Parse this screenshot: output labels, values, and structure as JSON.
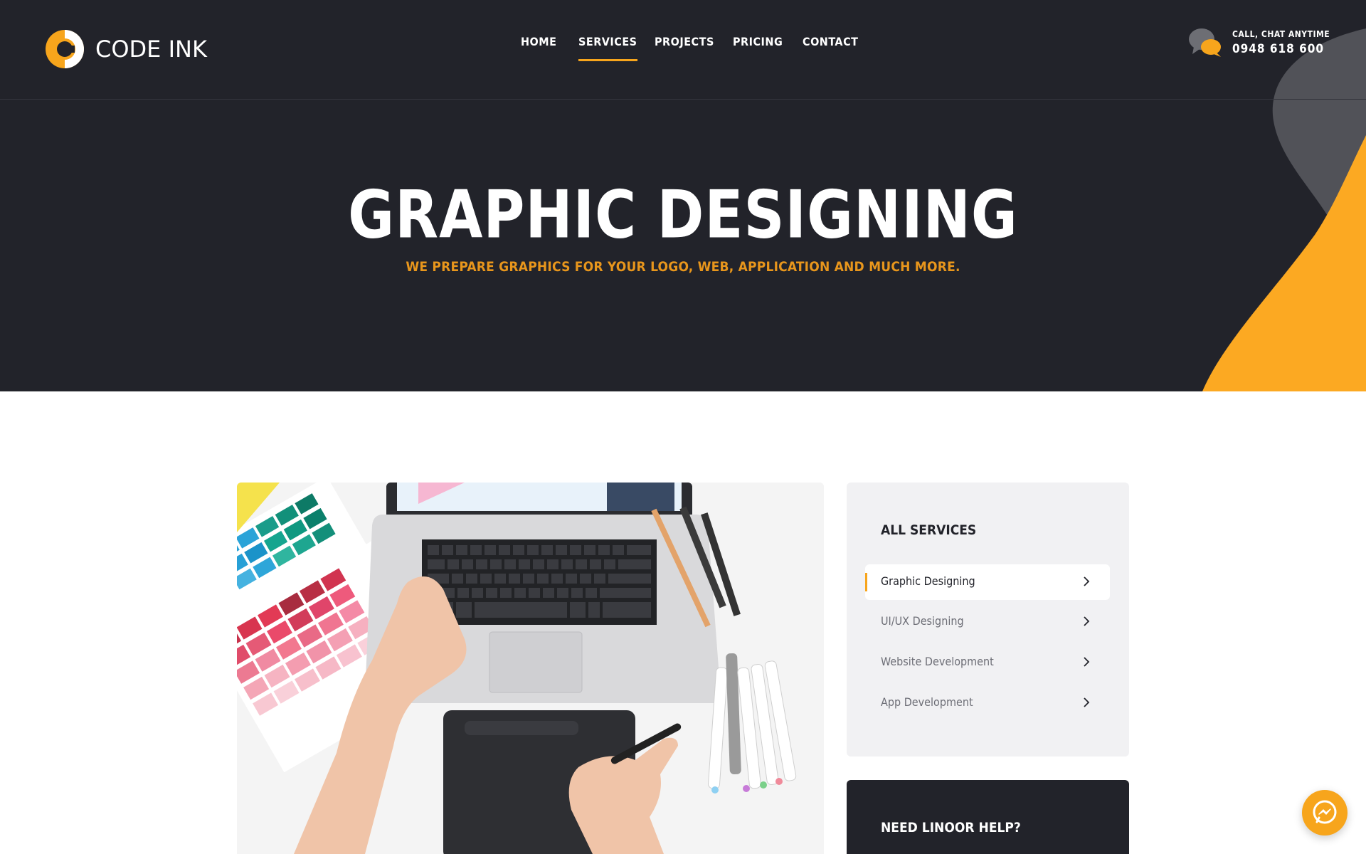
{
  "brand": {
    "name": "CODE INK",
    "accent": "#f7a51c",
    "dark": "#22232a"
  },
  "nav": {
    "items": [
      {
        "label": "HOME",
        "active": false
      },
      {
        "label": "SERVICES",
        "active": true
      },
      {
        "label": "PROJECTS",
        "active": false
      },
      {
        "label": "PRICING",
        "active": false
      },
      {
        "label": "CONTACT",
        "active": false
      }
    ]
  },
  "contact": {
    "label": "CALL, CHAT ANYTIME",
    "phone": "0948 618 600",
    "icon": "chat-bubbles-icon"
  },
  "hero": {
    "title": "GRAPHIC DESIGNING",
    "subtitle": "WE PREPARE GRAPHICS FOR YOUR LOGO, WEB, APPLICATION AND MUCH MORE."
  },
  "sidebar": {
    "title": "ALL SERVICES",
    "items": [
      {
        "label": "Graphic Designing",
        "active": true
      },
      {
        "label": "UI/UX Designing",
        "active": false
      },
      {
        "label": "Website Development",
        "active": false
      },
      {
        "label": "App Development",
        "active": false
      }
    ]
  },
  "help": {
    "title": "NEED LINOOR HELP?"
  },
  "messenger": {
    "icon": "messenger-icon"
  }
}
